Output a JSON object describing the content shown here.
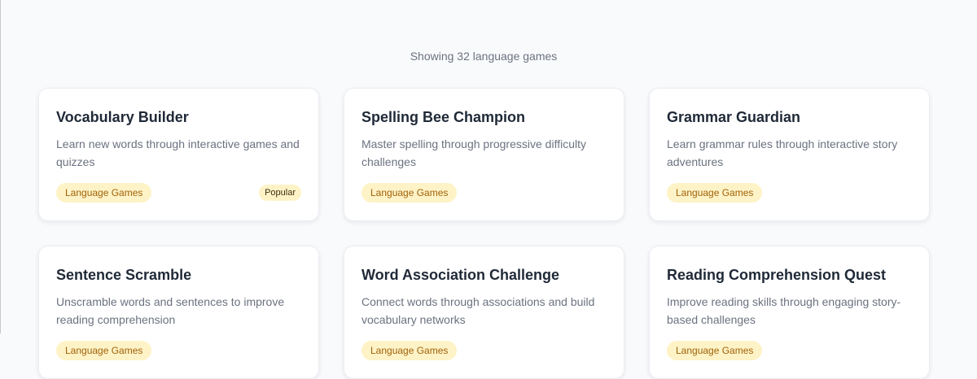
{
  "results": {
    "count_text": "Showing 32 language games"
  },
  "games": [
    {
      "title": "Vocabulary Builder",
      "description": "Learn new words through interactive games and quizzes",
      "category": "Language Games",
      "badge": "Popular"
    },
    {
      "title": "Spelling Bee Champion",
      "description": "Master spelling through progressive difficulty challenges",
      "category": "Language Games",
      "badge": ""
    },
    {
      "title": "Grammar Guardian",
      "description": "Learn grammar rules through interactive story adventures",
      "category": "Language Games",
      "badge": ""
    },
    {
      "title": "Sentence Scramble",
      "description": "Unscramble words and sentences to improve reading comprehension",
      "category": "Language Games",
      "badge": ""
    },
    {
      "title": "Word Association Challenge",
      "description": "Connect words through associations and build vocabulary networks",
      "category": "Language Games",
      "badge": ""
    },
    {
      "title": "Reading Comprehension Quest",
      "description": "Improve reading skills through engaging story-based challenges",
      "category": "Language Games",
      "badge": ""
    }
  ]
}
